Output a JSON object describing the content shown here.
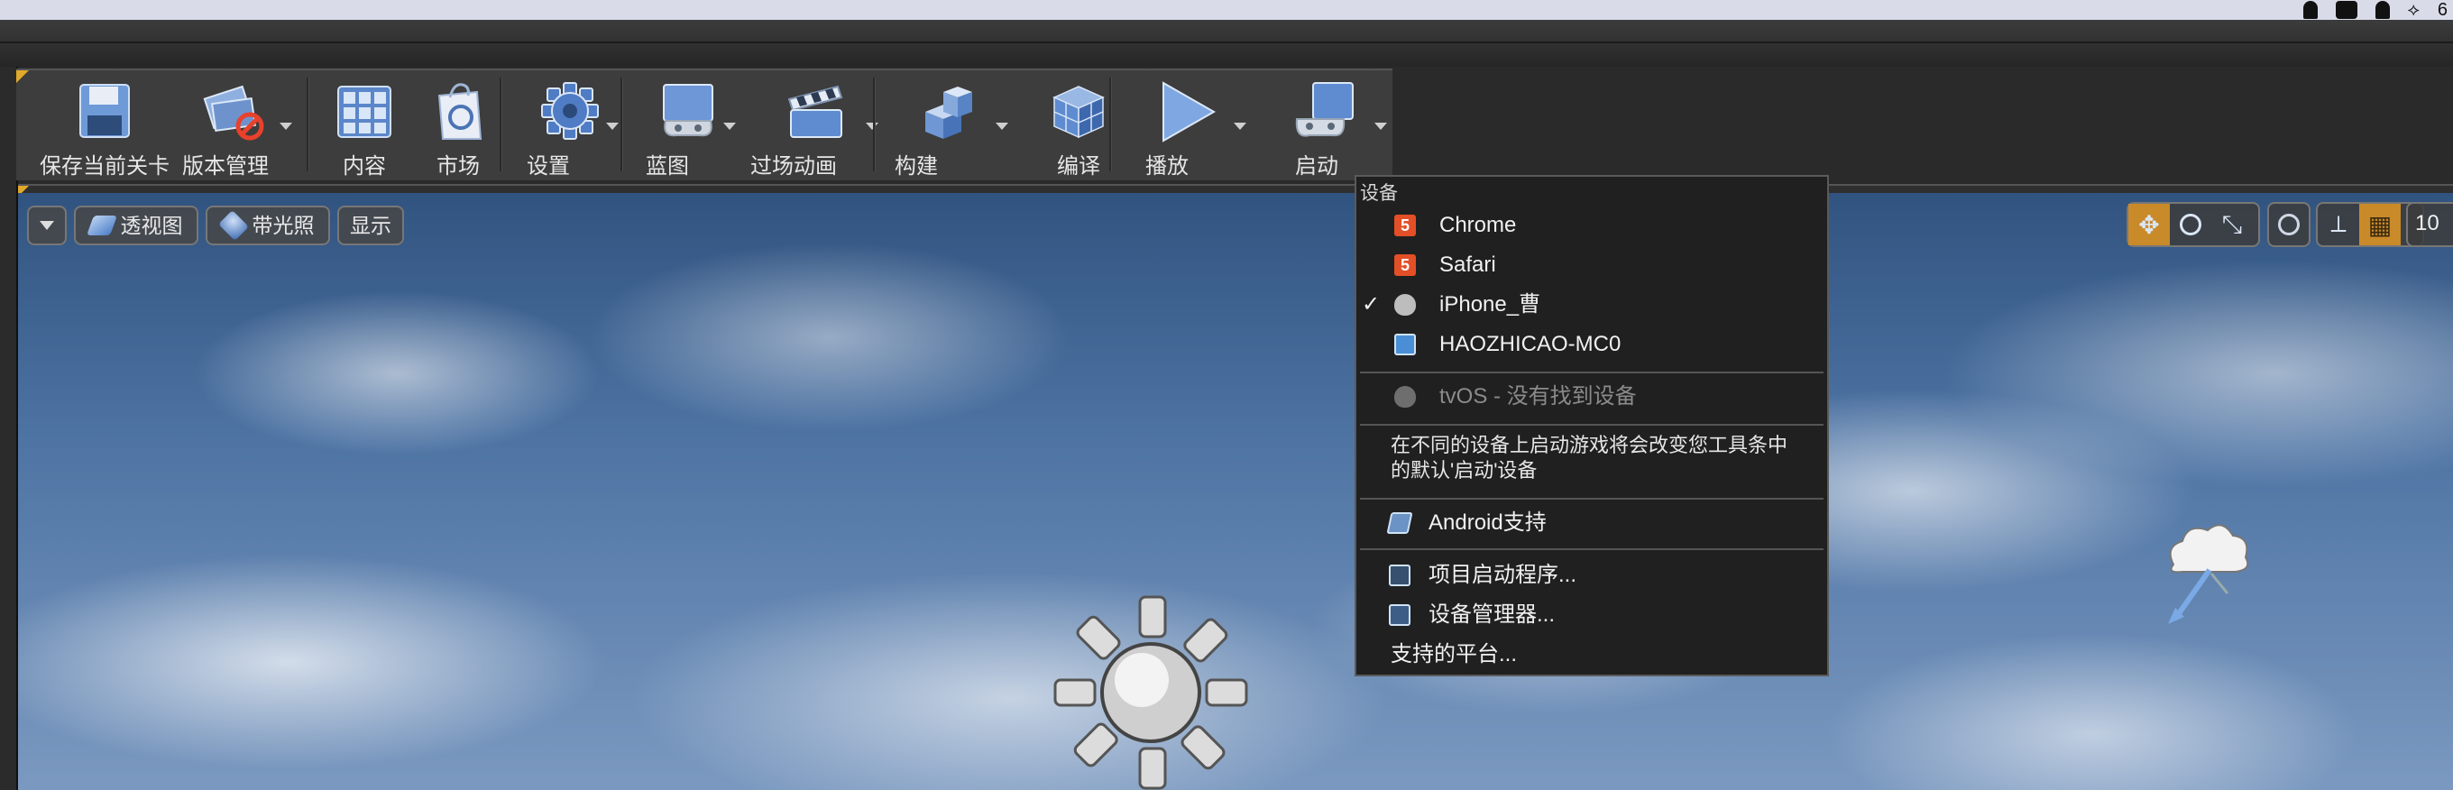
{
  "os_bar": {
    "right_text": "6",
    "icons": [
      "penguin-icon",
      "terminal-icon",
      "shield-icon",
      "network-icon"
    ]
  },
  "toolbar": {
    "save_label": "保存当前关卡",
    "source_control_label": "版本管理",
    "content_label": "内容",
    "marketplace_label": "市场",
    "settings_label": "设置",
    "blueprints_label": "蓝图",
    "cinematics_label": "过场动画",
    "build_label": "构建",
    "compile_label": "编译",
    "play_label": "播放",
    "launch_label": "启动"
  },
  "viewport": {
    "perspective_label": "透视图",
    "lit_label": "带光照",
    "show_label": "显示",
    "grid_snap_value": "10",
    "accent_color": "#c98a2a"
  },
  "launch_menu": {
    "section_header": "设备",
    "devices": [
      {
        "label": "Chrome",
        "icon": "html5-icon",
        "checked": false
      },
      {
        "label": "Safari",
        "icon": "html5-icon",
        "checked": false
      },
      {
        "label": "iPhone_曹",
        "icon": "apple-icon",
        "checked": true
      },
      {
        "label": "HAOZHICAO-MC0",
        "icon": "mac-monitor-icon",
        "checked": false
      }
    ],
    "check_mark": "✓",
    "tvos_label": "tvOS - 没有找到设备",
    "note_line1": "在不同的设备上启动游戏将会改变您工具条中",
    "note_line2": "的默认'启动'设备",
    "android_label": "Android支持",
    "project_launcher_label": "项目启动程序...",
    "device_manager_label": "设备管理器...",
    "supported_platforms_label": "支持的平台..."
  }
}
